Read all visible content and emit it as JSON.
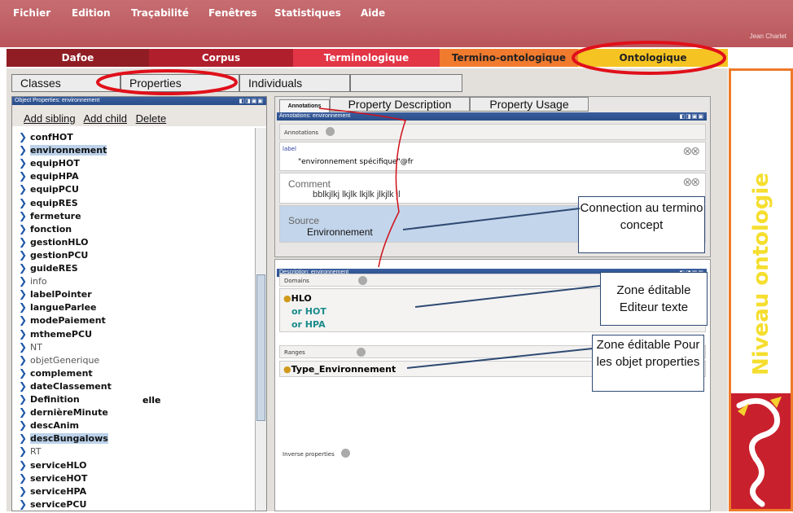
{
  "menubar": {
    "items": [
      "Fichier",
      "Edition",
      "Traçabilité",
      "Fenêtres",
      "Statistiques",
      "Aide"
    ],
    "user": "Jean Charlet"
  },
  "main_tabs": [
    "Dafoe",
    "Corpus",
    "Terminologique",
    "Termino-ontologique",
    "Ontologique"
  ],
  "sub_tabs": [
    "Classes",
    "Properties",
    "Individuals"
  ],
  "left_panel": {
    "header": "Object Properties: environnement",
    "actions": [
      "Add sibling",
      "Add child",
      "Delete"
    ],
    "tree": [
      {
        "label": "confHOT",
        "style": "bold"
      },
      {
        "label": "environnement",
        "style": "sel"
      },
      {
        "label": "equipHOT",
        "style": "bold"
      },
      {
        "label": "equipHPA",
        "style": "bold"
      },
      {
        "label": "equipPCU",
        "style": "bold"
      },
      {
        "label": "equipRES",
        "style": "bold"
      },
      {
        "label": "fermeture",
        "style": "bold"
      },
      {
        "label": "fonction",
        "style": "bold"
      },
      {
        "label": "gestionHLO",
        "style": "bold"
      },
      {
        "label": "gestionPCU",
        "style": "bold"
      },
      {
        "label": "guideRES",
        "style": "bold"
      },
      {
        "label": "info",
        "style": "norm"
      },
      {
        "label": "labelPointer",
        "style": "bold"
      },
      {
        "label": "langueParlee",
        "style": "bold"
      },
      {
        "label": "modePaiement",
        "style": "bold"
      },
      {
        "label": "mthemePCU",
        "style": "bold"
      },
      {
        "label": "NT",
        "style": "norm"
      },
      {
        "label": "objetGenerique",
        "style": "norm"
      },
      {
        "label": "complement",
        "style": "bold"
      },
      {
        "label": "dateClassement",
        "style": "bold"
      },
      {
        "label": "Definition",
        "style": "bold"
      },
      {
        "label": "dernièreMinute",
        "style": "bold"
      },
      {
        "label": "descAnim",
        "style": "bold"
      },
      {
        "label": "descBungalows",
        "style": "sel"
      },
      {
        "label": "RT",
        "style": "norm"
      },
      {
        "label": "serviceHLO",
        "style": "bold"
      },
      {
        "label": "serviceHOT",
        "style": "bold"
      },
      {
        "label": "serviceHPA",
        "style": "bold"
      },
      {
        "label": "servicePCU",
        "style": "bold"
      }
    ],
    "stray": "elle"
  },
  "annotations": {
    "tabs": [
      "Annotations",
      "Property Description",
      "Property Usage"
    ],
    "header": "Annotations: environnement",
    "section": "Annotations",
    "label_key": "label",
    "label_value": "\"environnement spécifique\"@fr",
    "comment_key": "Comment",
    "comment_value": "bblkjlkj lkjlk lkjlk jlkjlk jl",
    "source_key": "Source",
    "source_value": "Environnement"
  },
  "description": {
    "header": "Description: environnement",
    "domains_label": "Domains",
    "domains": [
      "HLO",
      "or HOT",
      "or HPA"
    ],
    "ranges_label": "Ranges",
    "range": "Type_Environnement",
    "inverse_label": "Inverse properties"
  },
  "callouts": [
    "Connection au termino concept",
    "Zone éditable Editeur texte",
    "Zone éditable Pour les objet properties"
  ],
  "banner": {
    "text": "Niveau ontologie"
  }
}
